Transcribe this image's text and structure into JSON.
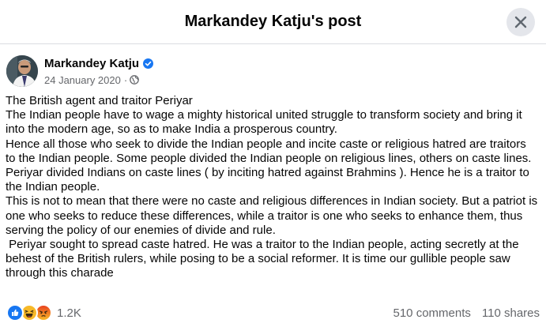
{
  "header": {
    "title": "Markandey Katju's post"
  },
  "author": {
    "name": "Markandey Katju",
    "date": "24 January 2020",
    "separator": "·"
  },
  "post": {
    "lines": [
      "The British agent and traitor Periyar",
      "The Indian people have to wage a mighty historical united struggle to transform society and bring it",
      "into the modern age, so as to make India a prosperous country.",
      "Hence all those who seek to divide the Indian people and incite caste or religious hatred are traitors",
      "to the Indian people. Some people divided the Indian people on religious lines, others on caste lines.",
      "Periyar divided Indians on caste lines ( by inciting hatred against Brahmins ). Hence he is a traitor to",
      "the Indian people.",
      "This is not to mean that there were no caste and religious differences in Indian society. But a patriot is",
      "one who seeks to reduce these differences, while a traitor is one who seeks to enhance them, thus",
      "serving the policy of our enemies of divide and rule.",
      " Periyar sought to spread caste hatred. He was a traitor to the Indian people, acting secretly at the",
      "behest of the British rulers, while posing to be a social reformer. It is time our gullible people saw",
      "through this charade"
    ]
  },
  "footer": {
    "reaction_icons": [
      "like-icon",
      "haha-icon",
      "angry-icon"
    ],
    "reaction_count": "1.2K",
    "comments": "510 comments",
    "shares": "110 shares"
  },
  "colors": {
    "like": "#1877f2",
    "haha": "#f7b928",
    "angry": "#e9710f",
    "verified": "#1877f2",
    "secondary_text": "#65676b"
  }
}
